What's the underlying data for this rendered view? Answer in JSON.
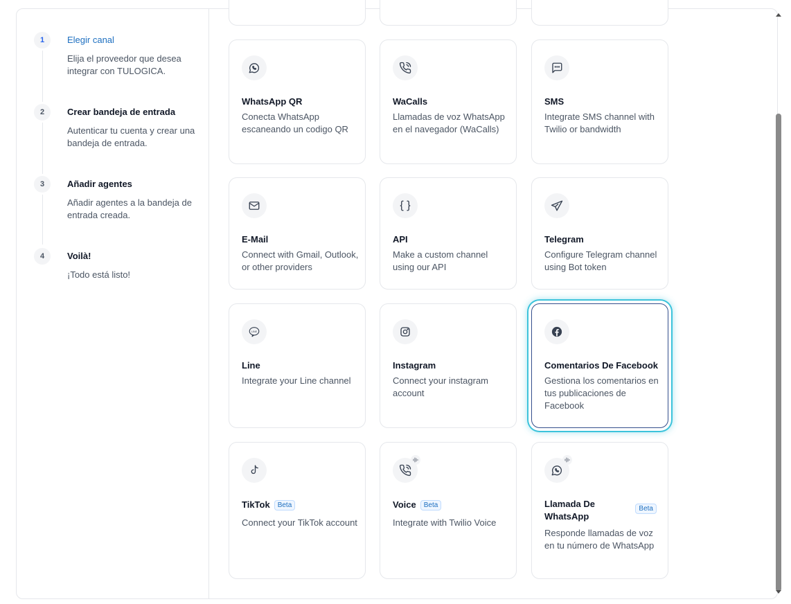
{
  "steps": [
    {
      "num": "1",
      "title": "Elegir canal",
      "desc": "Elija el proveedor que desea integrar con TULOGICA."
    },
    {
      "num": "2",
      "title": "Crear bandeja de entrada",
      "desc": "Autenticar tu cuenta y crear una bandeja de entrada."
    },
    {
      "num": "3",
      "title": "Añadir agentes",
      "desc": "Añadir agentes a la bandeja de entrada creada."
    },
    {
      "num": "4",
      "title": "Voilà!",
      "desc": "¡Todo está listo!"
    }
  ],
  "channels": [
    {
      "title": "WhatsApp QR",
      "desc": "Conecta WhatsApp escaneando un codigo QR",
      "icon": "whatsapp-icon"
    },
    {
      "title": "WaCalls",
      "desc": "Llamadas de voz WhatsApp en el navegador (WaCalls)",
      "icon": "phone-call-icon"
    },
    {
      "title": "SMS",
      "desc": "Integrate SMS channel with Twilio or bandwidth",
      "icon": "message-icon"
    },
    {
      "title": "E-Mail",
      "desc": "Connect with Gmail, Outlook, or other providers",
      "icon": "mail-icon"
    },
    {
      "title": "API",
      "desc": "Make a custom channel using our API",
      "icon": "braces-icon"
    },
    {
      "title": "Telegram",
      "desc": "Configure Telegram channel using Bot token",
      "icon": "send-icon"
    },
    {
      "title": "Line",
      "desc": "Integrate your Line channel",
      "icon": "line-icon"
    },
    {
      "title": "Instagram",
      "desc": "Connect your instagram account",
      "icon": "instagram-icon"
    },
    {
      "title": "Comentarios De Facebook",
      "desc": "Gestiona los comentarios en tus publicaciones de Facebook",
      "icon": "facebook-icon"
    },
    {
      "title": "TikTok",
      "desc": "Connect your TikTok account",
      "icon": "tiktok-icon",
      "badge": "Beta"
    },
    {
      "title": "Voice",
      "desc": "Integrate with Twilio Voice",
      "icon": "phone-call-icon",
      "badge": "Beta"
    },
    {
      "title": "Llamada De WhatsApp",
      "desc": "Responde llamadas de voz en tu número de WhatsApp",
      "icon": "whatsapp-icon",
      "badge": "Beta"
    }
  ],
  "line_icon_text": "LINE",
  "colors": {
    "accent": "#1d6fc0",
    "selected_glow": "#3cc3db",
    "selected_border": "#334e8c"
  }
}
